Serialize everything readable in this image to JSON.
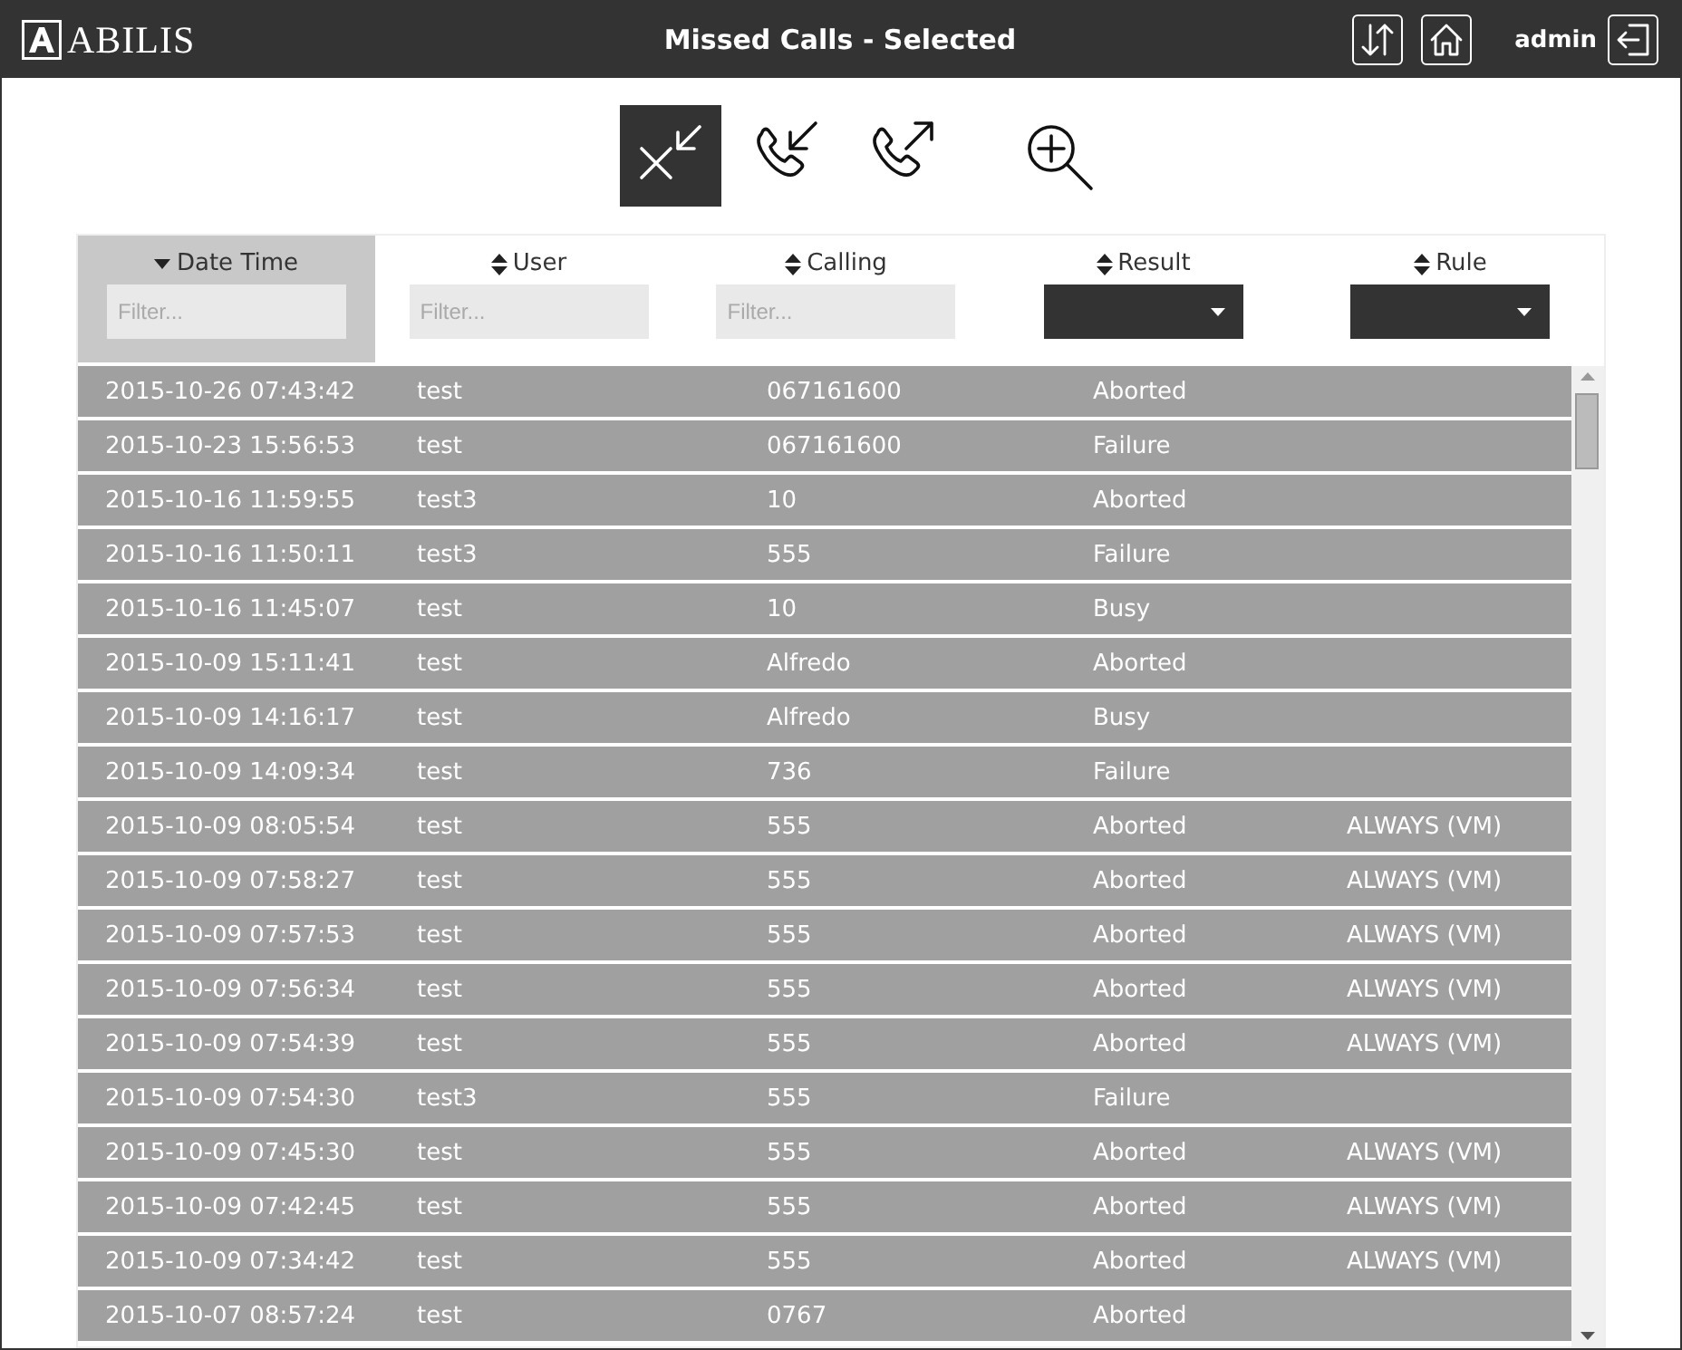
{
  "header": {
    "logo": "ABILIS",
    "title": "Missed Calls - Selected",
    "user": "admin"
  },
  "toolbar": [
    {
      "kind": "missed",
      "selected": true
    },
    {
      "kind": "incoming",
      "selected": false
    },
    {
      "kind": "outgoing",
      "selected": false
    },
    {
      "kind": "zoom",
      "selected": false
    }
  ],
  "table": {
    "columns": [
      {
        "label": "Date Time",
        "sorted": true,
        "selected": true,
        "filter": {
          "kind": "text",
          "placeholder": "Filter..."
        }
      },
      {
        "label": "User",
        "sorted": false,
        "selected": false,
        "filter": {
          "kind": "text",
          "placeholder": "Filter..."
        }
      },
      {
        "label": "Calling",
        "sorted": false,
        "selected": false,
        "filter": {
          "kind": "text",
          "placeholder": "Filter..."
        }
      },
      {
        "label": "Result",
        "sorted": false,
        "selected": false,
        "filter": {
          "kind": "select"
        }
      },
      {
        "label": "Rule",
        "sorted": false,
        "selected": false,
        "filter": {
          "kind": "select"
        }
      }
    ],
    "rows": [
      [
        "2015-10-26 07:43:42",
        "test",
        "067161600",
        "Aborted",
        ""
      ],
      [
        "2015-10-23 15:56:53",
        "test",
        "067161600",
        "Failure",
        ""
      ],
      [
        "2015-10-16 11:59:55",
        "test3",
        "10",
        "Aborted",
        ""
      ],
      [
        "2015-10-16 11:50:11",
        "test3",
        "555",
        "Failure",
        ""
      ],
      [
        "2015-10-16 11:45:07",
        "test",
        "10",
        "Busy",
        ""
      ],
      [
        "2015-10-09 15:11:41",
        "test",
        "Alfredo",
        "Aborted",
        ""
      ],
      [
        "2015-10-09 14:16:17",
        "test",
        "Alfredo",
        "Busy",
        ""
      ],
      [
        "2015-10-09 14:09:34",
        "test",
        "736",
        "Failure",
        ""
      ],
      [
        "2015-10-09 08:05:54",
        "test",
        "555",
        "Aborted",
        "ALWAYS (VM)"
      ],
      [
        "2015-10-09 07:58:27",
        "test",
        "555",
        "Aborted",
        "ALWAYS (VM)"
      ],
      [
        "2015-10-09 07:57:53",
        "test",
        "555",
        "Aborted",
        "ALWAYS (VM)"
      ],
      [
        "2015-10-09 07:56:34",
        "test",
        "555",
        "Aborted",
        "ALWAYS (VM)"
      ],
      [
        "2015-10-09 07:54:39",
        "test",
        "555",
        "Aborted",
        "ALWAYS (VM)"
      ],
      [
        "2015-10-09 07:54:30",
        "test3",
        "555",
        "Failure",
        ""
      ],
      [
        "2015-10-09 07:45:30",
        "test",
        "555",
        "Aborted",
        "ALWAYS (VM)"
      ],
      [
        "2015-10-09 07:42:45",
        "test",
        "555",
        "Aborted",
        "ALWAYS (VM)"
      ],
      [
        "2015-10-09 07:34:42",
        "test",
        "555",
        "Aborted",
        "ALWAYS (VM)"
      ],
      [
        "2015-10-07 08:57:24",
        "test",
        "0767",
        "Aborted",
        ""
      ]
    ]
  }
}
